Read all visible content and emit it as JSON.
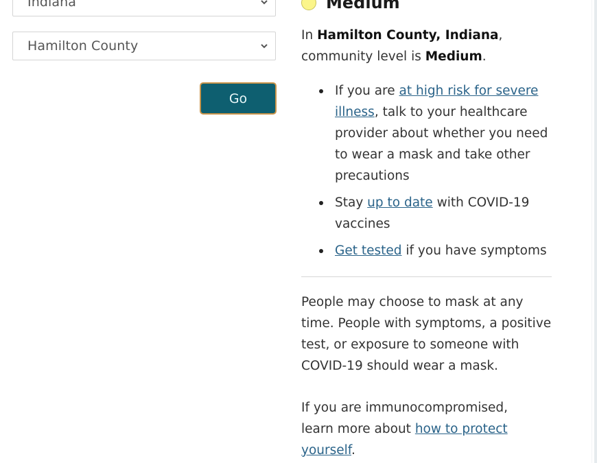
{
  "location": {
    "state_value": "Indiana",
    "county_value": "Hamilton County",
    "go_label": "Go"
  },
  "result": {
    "level_label": "Medium",
    "level_color": "#fbf58a",
    "summary_prefix": "In ",
    "summary_place": "Hamilton County, Indiana",
    "summary_mid": ",",
    "summary_line2": "community level is ",
    "summary_level": "Medium",
    "summary_end": "."
  },
  "bullets": [
    {
      "pre": "If you are ",
      "link": "at high risk for severe illness",
      "post": ", talk to your healthcare provider about whether you need to wear a mask and take other precautions"
    },
    {
      "pre": "Stay ",
      "link": "up to date",
      "post": " with COVID-19 vaccines"
    },
    {
      "pre": "",
      "link": "Get tested",
      "post": " if you have symptoms"
    }
  ],
  "mask_note": "People may choose to mask at any time. People with symptoms, a positive test, or exposure to someone with COVID-19 should wear a mask.",
  "immuno": {
    "pre": "If you are immunocompromised, learn more about ",
    "link": "how to protect yourself",
    "post": "."
  }
}
